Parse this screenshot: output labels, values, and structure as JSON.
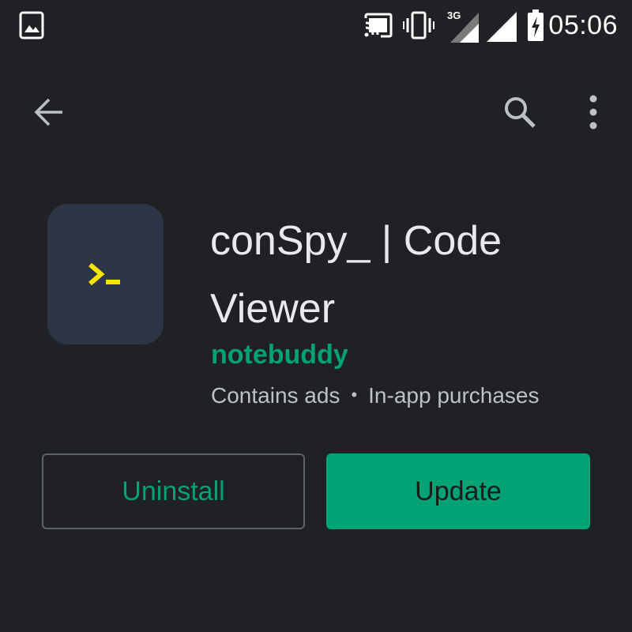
{
  "status_bar": {
    "time": "05:06",
    "network_label": "3G",
    "icons": [
      "image-notification-icon",
      "cast-icon",
      "vibrate-icon",
      "mobile-signal-icon",
      "wifi-signal-icon",
      "battery-charging-icon"
    ]
  },
  "toolbar": {
    "back_icon": "arrow-back-icon",
    "search_icon": "search-icon",
    "menu_icon": "more-vert-icon"
  },
  "app": {
    "title": "conSpy_ | Code Viewer",
    "developer": "notebuddy",
    "meta_ads": "Contains ads",
    "meta_separator": "•",
    "meta_purchases": "In-app purchases",
    "icon_glyph": "›_",
    "icon_bg_color": "#2c3646",
    "icon_glyph_color": "#f5e500"
  },
  "actions": {
    "uninstall_label": "Uninstall",
    "update_label": "Update"
  },
  "colors": {
    "background": "#202124",
    "accent": "#01a274",
    "text_primary": "#e8eaed",
    "text_secondary": "#bdc1c6"
  }
}
